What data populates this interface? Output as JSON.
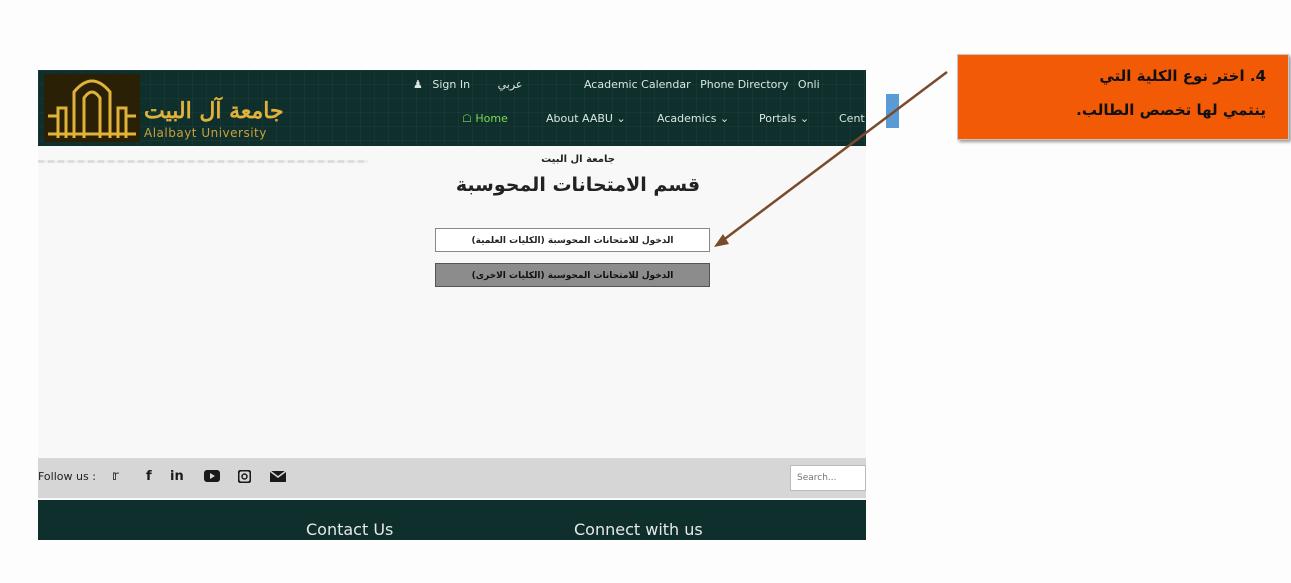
{
  "header": {
    "logo_arabic": "جامعة آل البيت",
    "logo_english": "Alalbayt University",
    "top_links": {
      "sign_in": "Sign In",
      "language": "عربي",
      "calendar": "Academic Calendar",
      "phone": "Phone Directory",
      "online": "Onli"
    },
    "nav": {
      "home": "Home",
      "about": "About AABU ⌄",
      "academics": "Academics ⌄",
      "portals": "Portals ⌄",
      "centers": "Cent"
    }
  },
  "main": {
    "university": "جامعة ال البيت",
    "title": "قسم الامتحانات المحوسبة",
    "button_science": "الدخول للامتحانات المحوسبة (الكليات العلمية)",
    "button_other": "الدخول للامتحانات المحوسبة (الكليات الاخرى)"
  },
  "footer": {
    "follow": "Follow us :",
    "social": [
      "twitter-icon",
      "facebook-icon",
      "linkedin-icon",
      "youtube-icon",
      "instagram-icon",
      "email-icon"
    ],
    "search_placeholder": "Search...",
    "contact": "Contact Us",
    "connect": "Connect with us"
  },
  "callout": {
    "line1": "4. اختر نوع الكلية التي",
    "line2": "ينتمي لها تخصص الطالب."
  },
  "colors": {
    "header_bg": "#0f2f2c",
    "callout_bg": "#f25a06",
    "home_green": "#7ed957"
  }
}
